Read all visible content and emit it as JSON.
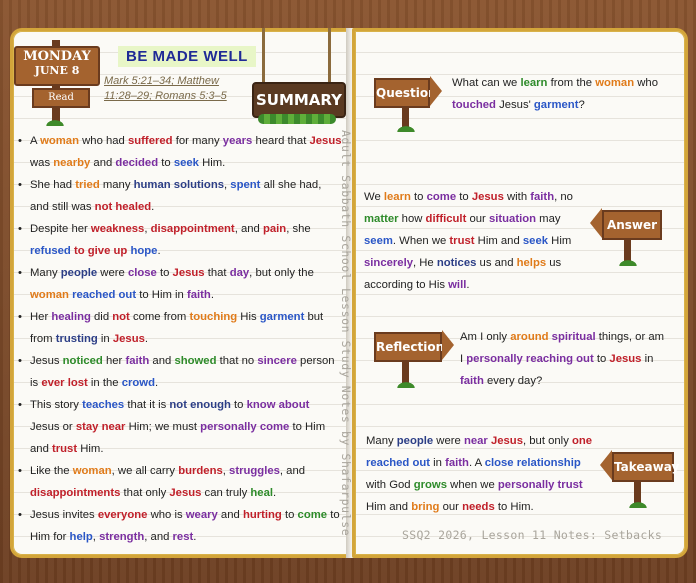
{
  "colors": {
    "orange": "#e07b1a",
    "red": "#c0202a",
    "blue": "#2a56c6",
    "green": "#2e8b2a",
    "purple": "#7a2ea0",
    "navy": "#2c3e86",
    "black": "#222222"
  },
  "header": {
    "day": "MONDAY",
    "date": "JUNE 8",
    "read_label": "Read",
    "title": "BE MADE WELL",
    "references": "Mark 5:21–34; Matthew 11:28–29; Romans 5:3–5",
    "summary_label": "SUMMARY"
  },
  "spine_text": "Adult Sabbath School Lesson Study Notes by Shafarpulse",
  "summary_points": [
    [
      [
        "A ",
        "black"
      ],
      [
        "woman",
        "orange"
      ],
      [
        " who had ",
        "black"
      ],
      [
        "suffered",
        "red"
      ],
      [
        " for many ",
        "black"
      ],
      [
        "years",
        "purple"
      ],
      [
        " heard that ",
        "black"
      ],
      [
        "Jesus",
        "red"
      ],
      [
        " was ",
        "black"
      ],
      [
        "nearby",
        "orange"
      ],
      [
        " and ",
        "black"
      ],
      [
        "decided",
        "purple"
      ],
      [
        " to ",
        "black"
      ],
      [
        "seek",
        "blue"
      ],
      [
        " Him.",
        "black"
      ]
    ],
    [
      [
        "She had ",
        "black"
      ],
      [
        "tried",
        "orange"
      ],
      [
        " many ",
        "black"
      ],
      [
        "human solutions",
        "navy"
      ],
      [
        ", ",
        "black"
      ],
      [
        "spent",
        "blue"
      ],
      [
        " all she had, and still was ",
        "black"
      ],
      [
        "not healed",
        "red"
      ],
      [
        ".",
        "black"
      ]
    ],
    [
      [
        "Despite her ",
        "black"
      ],
      [
        "weakness",
        "red"
      ],
      [
        ", ",
        "black"
      ],
      [
        "disappointment",
        "red"
      ],
      [
        ", and ",
        "black"
      ],
      [
        "pain",
        "red"
      ],
      [
        ", she ",
        "black"
      ],
      [
        "refused",
        "blue"
      ],
      [
        " ",
        "black"
      ],
      [
        "to give up",
        "red"
      ],
      [
        " ",
        "black"
      ],
      [
        "hope",
        "blue"
      ],
      [
        ".",
        "black"
      ]
    ],
    [
      [
        "Many ",
        "black"
      ],
      [
        "people",
        "navy"
      ],
      [
        " were ",
        "black"
      ],
      [
        "close",
        "purple"
      ],
      [
        " to ",
        "black"
      ],
      [
        "Jesus",
        "red"
      ],
      [
        " that ",
        "black"
      ],
      [
        "day",
        "purple"
      ],
      [
        ", but only the ",
        "black"
      ],
      [
        "woman",
        "orange"
      ],
      [
        " ",
        "black"
      ],
      [
        "reached out",
        "blue"
      ],
      [
        " to Him in ",
        "black"
      ],
      [
        "faith",
        "purple"
      ],
      [
        ".",
        "black"
      ]
    ],
    [
      [
        "Her ",
        "black"
      ],
      [
        "healing",
        "purple"
      ],
      [
        " did ",
        "black"
      ],
      [
        "not",
        "red"
      ],
      [
        " come from ",
        "black"
      ],
      [
        "touching",
        "orange"
      ],
      [
        " His ",
        "black"
      ],
      [
        "garment",
        "blue"
      ],
      [
        " but from ",
        "black"
      ],
      [
        "trusting",
        "navy"
      ],
      [
        " in ",
        "black"
      ],
      [
        "Jesus",
        "red"
      ],
      [
        ".",
        "black"
      ]
    ],
    [
      [
        "Jesus ",
        "black"
      ],
      [
        "noticed",
        "green"
      ],
      [
        " her ",
        "black"
      ],
      [
        "faith",
        "purple"
      ],
      [
        " and ",
        "black"
      ],
      [
        "showed",
        "green"
      ],
      [
        " that no ",
        "black"
      ],
      [
        "sincere",
        "purple"
      ],
      [
        " person is ",
        "black"
      ],
      [
        "ever lost",
        "red"
      ],
      [
        " in the ",
        "black"
      ],
      [
        "crowd",
        "blue"
      ],
      [
        ".",
        "black"
      ]
    ],
    [
      [
        "This story ",
        "black"
      ],
      [
        "teaches",
        "blue"
      ],
      [
        " that it is ",
        "black"
      ],
      [
        "not enough",
        "navy"
      ],
      [
        " to ",
        "black"
      ],
      [
        "know about",
        "purple"
      ],
      [
        " Jesus or ",
        "black"
      ],
      [
        "stay near",
        "red"
      ],
      [
        " Him; we must ",
        "black"
      ],
      [
        "personally come",
        "purple"
      ],
      [
        " to Him and ",
        "black"
      ],
      [
        "trust",
        "red"
      ],
      [
        " Him.",
        "black"
      ]
    ],
    [
      [
        "Like the ",
        "black"
      ],
      [
        "woman",
        "orange"
      ],
      [
        ", we all carry ",
        "black"
      ],
      [
        "burdens",
        "red"
      ],
      [
        ", ",
        "black"
      ],
      [
        "struggles",
        "purple"
      ],
      [
        ", and ",
        "black"
      ],
      [
        "disappointments",
        "red"
      ],
      [
        " that only ",
        "black"
      ],
      [
        "Jesus",
        "red"
      ],
      [
        " can truly ",
        "black"
      ],
      [
        "heal",
        "green"
      ],
      [
        ".",
        "black"
      ]
    ],
    [
      [
        "Jesus invites ",
        "black"
      ],
      [
        "everyone",
        "red"
      ],
      [
        " who is ",
        "black"
      ],
      [
        "weary",
        "purple"
      ],
      [
        " and ",
        "black"
      ],
      [
        "hurting",
        "red"
      ],
      [
        " to ",
        "black"
      ],
      [
        "come",
        "green"
      ],
      [
        " to Him for ",
        "black"
      ],
      [
        "help",
        "blue"
      ],
      [
        ", ",
        "black"
      ],
      [
        "strength",
        "purple"
      ],
      [
        ", and ",
        "black"
      ],
      [
        "rest",
        "purple"
      ],
      [
        ".",
        "black"
      ]
    ]
  ],
  "question": {
    "label": "Question",
    "text": [
      [
        "What can we ",
        "black"
      ],
      [
        "learn",
        "green"
      ],
      [
        " from the ",
        "black"
      ],
      [
        "woman",
        "orange"
      ],
      [
        " who ",
        "black"
      ],
      [
        "touched",
        "purple"
      ],
      [
        " Jesus' ",
        "black"
      ],
      [
        "garment",
        "blue"
      ],
      [
        "?",
        "black"
      ]
    ]
  },
  "answer": {
    "label": "Answer",
    "text": [
      [
        "We ",
        "black"
      ],
      [
        "learn",
        "orange"
      ],
      [
        " to ",
        "black"
      ],
      [
        "come",
        "purple"
      ],
      [
        " to ",
        "black"
      ],
      [
        "Jesus",
        "red"
      ],
      [
        " with ",
        "black"
      ],
      [
        "faith",
        "purple"
      ],
      [
        ", no ",
        "black"
      ],
      [
        "matter",
        "green"
      ],
      [
        " how ",
        "black"
      ],
      [
        "difficult",
        "red"
      ],
      [
        " our ",
        "black"
      ],
      [
        "situation",
        "purple"
      ],
      [
        " may ",
        "black"
      ],
      [
        "seem",
        "blue"
      ],
      [
        ". When we ",
        "black"
      ],
      [
        "trust",
        "red"
      ],
      [
        " Him and ",
        "black"
      ],
      [
        "seek",
        "blue"
      ],
      [
        " Him ",
        "black"
      ],
      [
        "sincerely",
        "purple"
      ],
      [
        ", He ",
        "black"
      ],
      [
        "notices",
        "navy"
      ],
      [
        " us and ",
        "black"
      ],
      [
        "helps",
        "orange"
      ],
      [
        " us according to His ",
        "black"
      ],
      [
        "will",
        "purple"
      ],
      [
        ".",
        "black"
      ]
    ]
  },
  "reflection": {
    "label": "Reflection",
    "text": [
      [
        "Am I only ",
        "black"
      ],
      [
        "around",
        "orange"
      ],
      [
        " ",
        "black"
      ],
      [
        "spiritual",
        "purple"
      ],
      [
        " things, or am I ",
        "black"
      ],
      [
        "personally reaching out",
        "purple"
      ],
      [
        " to ",
        "black"
      ],
      [
        "Jesus",
        "red"
      ],
      [
        " in ",
        "black"
      ],
      [
        "faith",
        "purple"
      ],
      [
        " every day?",
        "black"
      ]
    ]
  },
  "takeaway": {
    "label": "Takeaway",
    "text": [
      [
        "Many ",
        "black"
      ],
      [
        "people",
        "navy"
      ],
      [
        " were ",
        "black"
      ],
      [
        "near",
        "purple"
      ],
      [
        " ",
        "black"
      ],
      [
        "Jesus",
        "red"
      ],
      [
        ", but only ",
        "black"
      ],
      [
        "one",
        "red"
      ],
      [
        " ",
        "black"
      ],
      [
        "reached out",
        "blue"
      ],
      [
        " in ",
        "black"
      ],
      [
        "faith",
        "purple"
      ],
      [
        ". A ",
        "black"
      ],
      [
        "close relationship",
        "blue"
      ],
      [
        " with God ",
        "black"
      ],
      [
        "grows",
        "green"
      ],
      [
        " when we ",
        "black"
      ],
      [
        "personally trust",
        "purple"
      ],
      [
        " Him and ",
        "black"
      ],
      [
        "bring",
        "orange"
      ],
      [
        " our ",
        "black"
      ],
      [
        "needs",
        "red"
      ],
      [
        " to Him.",
        "black"
      ]
    ]
  },
  "footer": "SSQ2 2026, Lesson 11 Notes: Setbacks"
}
